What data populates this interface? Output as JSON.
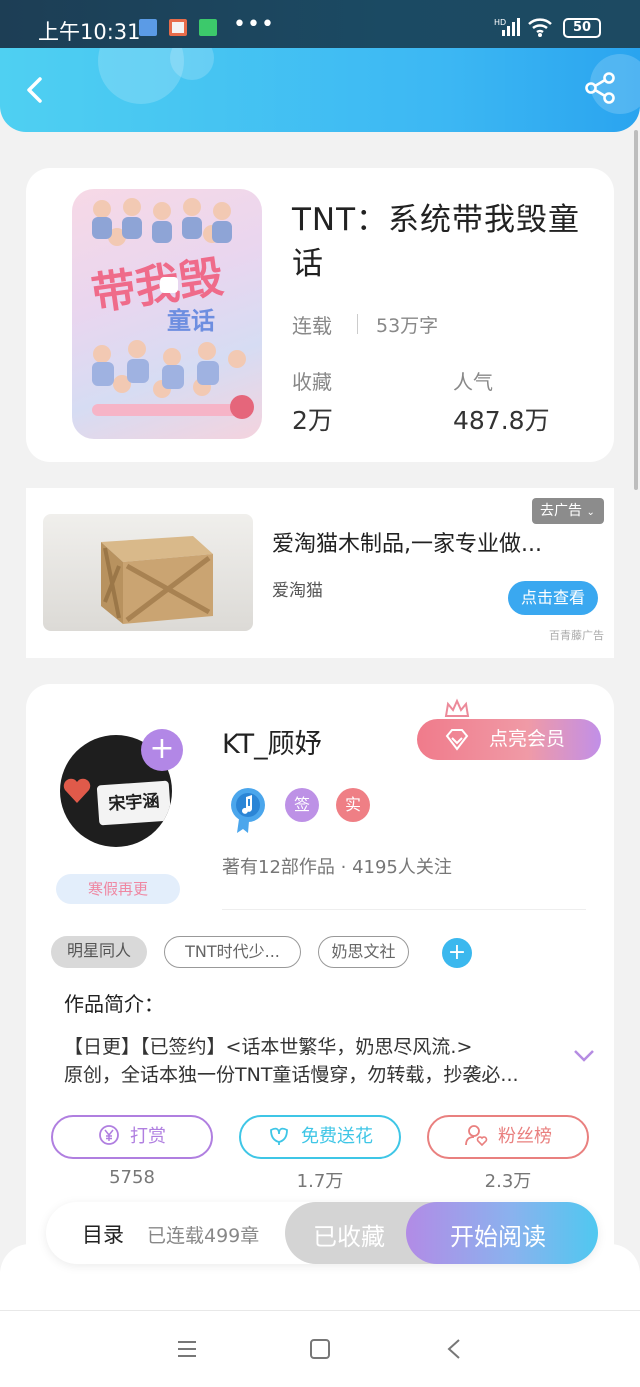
{
  "status_bar": {
    "time": "上午10:31",
    "battery": "50",
    "network": "HD"
  },
  "header": {
    "back_icon": "back-arrow-icon",
    "share_icon": "share-icon"
  },
  "book": {
    "title": "TNT：系统带我毁童话",
    "status": "连载",
    "word_count": "53万字",
    "favorites_label": "收藏",
    "favorites_value": "2万",
    "popularity_label": "人气",
    "popularity_value": "487.8万"
  },
  "ad": {
    "close_label": "去广告",
    "title": "爱淘猫木制品,一家专业做...",
    "brand": "爱淘猫",
    "cta": "点击查看",
    "source": "百青藤广告"
  },
  "author": {
    "name": "KT_顾妤",
    "vip_button": "点亮会员",
    "badge_sign": "签",
    "badge_real": "实",
    "stats": "著有12部作品 · 4195人关注",
    "sticker": "寒假再更",
    "avatar_text": "宋宇涵"
  },
  "tags": [
    "明星同人",
    "TNT时代少...",
    "奶思文社"
  ],
  "intro": {
    "heading": "作品简介：",
    "line1": "【日更】【已签约】<话本世繁华，奶思尽风流.>",
    "line2": "原创，全话本独一份TNT童话慢穿，勿转载，抄袭必..."
  },
  "actions": [
    {
      "label": "打赏",
      "count": "5758",
      "color": "#b07fe0"
    },
    {
      "label": "免费送花",
      "count": "1.7万",
      "color": "#3fc6e6"
    },
    {
      "label": "粉丝榜",
      "count": "2.3万",
      "color": "#e9807f"
    }
  ],
  "bottom": {
    "toc": "目录",
    "chapters": "已连载499章",
    "collected": "已收藏",
    "read": "开始阅读"
  }
}
